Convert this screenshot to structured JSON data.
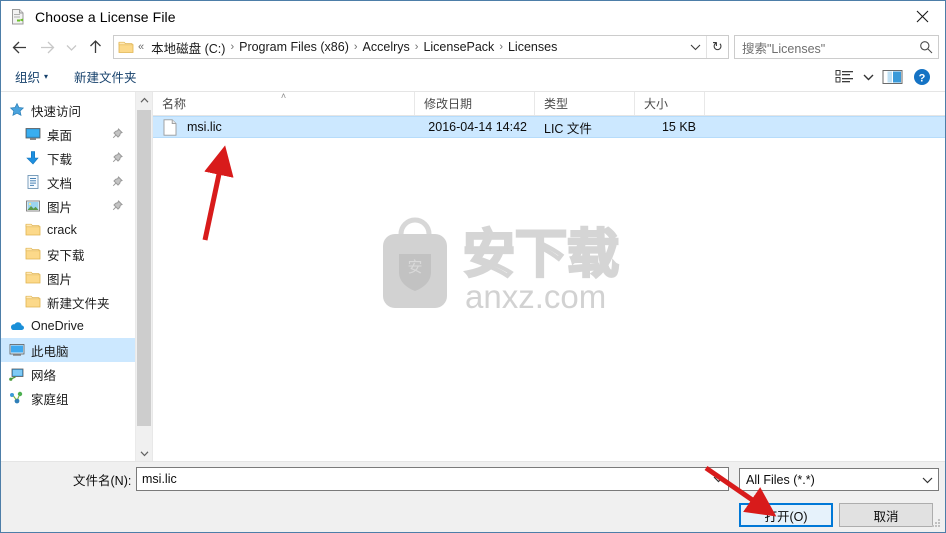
{
  "window": {
    "title": "Choose a License File",
    "icon": "license-file-icon",
    "close_label": "✕"
  },
  "nav": {
    "back": "←",
    "forward": "→",
    "recent": "˅",
    "up": "↑",
    "refresh": "↻",
    "dropdown": "˅"
  },
  "address": {
    "folder_icon": "folder-icon",
    "overflow": "«",
    "crumbs": [
      "本地磁盘 (C:)",
      "Program Files (x86)",
      "Accelrys",
      "LicensePack",
      "Licenses"
    ],
    "separator": "›"
  },
  "search": {
    "placeholder": "搜索\"Licenses\"",
    "value": "",
    "icon": "search-icon"
  },
  "toolbar": {
    "organize": "组织",
    "organize_caret": "▾",
    "new_folder": "新建文件夹",
    "view_icon": "view-list-icon",
    "view_caret": "▾",
    "preview_pane_icon": "preview-pane-icon",
    "help_icon": "help-icon"
  },
  "sidebar": {
    "items": [
      {
        "label": "快速访问",
        "icon": "star-icon",
        "indent": 0,
        "pinned": false,
        "selected": false
      },
      {
        "label": "桌面",
        "icon": "desktop-icon",
        "indent": 1,
        "pinned": true,
        "selected": false
      },
      {
        "label": "下载",
        "icon": "download-icon",
        "indent": 1,
        "pinned": true,
        "selected": false
      },
      {
        "label": "文档",
        "icon": "documents-icon",
        "indent": 1,
        "pinned": true,
        "selected": false
      },
      {
        "label": "图片",
        "icon": "pictures-icon",
        "indent": 1,
        "pinned": true,
        "selected": false
      },
      {
        "label": "crack",
        "icon": "folder-icon",
        "indent": 1,
        "pinned": false,
        "selected": false
      },
      {
        "label": "安下载",
        "icon": "folder-icon",
        "indent": 1,
        "pinned": false,
        "selected": false
      },
      {
        "label": "图片",
        "icon": "folder-icon",
        "indent": 1,
        "pinned": false,
        "selected": false
      },
      {
        "label": "新建文件夹",
        "icon": "folder-icon",
        "indent": 1,
        "pinned": false,
        "selected": false
      },
      {
        "label": "OneDrive",
        "icon": "onedrive-icon",
        "indent": 0,
        "pinned": false,
        "selected": false
      },
      {
        "label": "此电脑",
        "icon": "this-pc-icon",
        "indent": 0,
        "pinned": false,
        "selected": true
      },
      {
        "label": "网络",
        "icon": "network-icon",
        "indent": 0,
        "pinned": false,
        "selected": false
      },
      {
        "label": "家庭组",
        "icon": "homegroup-icon",
        "indent": 0,
        "pinned": false,
        "selected": false
      }
    ],
    "scroll_up": "˄",
    "scroll_down": "˅"
  },
  "filelist": {
    "columns": [
      {
        "key": "name",
        "label": "名称",
        "sorted": true,
        "sort_caret": "˄"
      },
      {
        "key": "date",
        "label": "修改日期",
        "sorted": false
      },
      {
        "key": "type",
        "label": "类型",
        "sorted": false
      },
      {
        "key": "size",
        "label": "大小",
        "sorted": false
      }
    ],
    "rows": [
      {
        "name": "msi.lic",
        "date": "2016-04-14 14:42",
        "type": "LIC 文件",
        "size": "15 KB",
        "icon": "generic-file-icon",
        "selected": true
      }
    ]
  },
  "watermark": {
    "cn_text": "安下载",
    "url_text": "anxz.com",
    "badge_text": "安"
  },
  "footer": {
    "filename_label": "文件名(N):",
    "filename_value": "msi.lic",
    "filename_caret": "˅",
    "filter_value": "All Files (*.*)",
    "filter_caret": "˅",
    "open_label": "打开(O)",
    "cancel_label": "取消"
  },
  "colors": {
    "selection": "#cce8ff",
    "accent": "#0078d7",
    "annotation": "#d81b1b",
    "toolbar_link": "#15406b"
  }
}
